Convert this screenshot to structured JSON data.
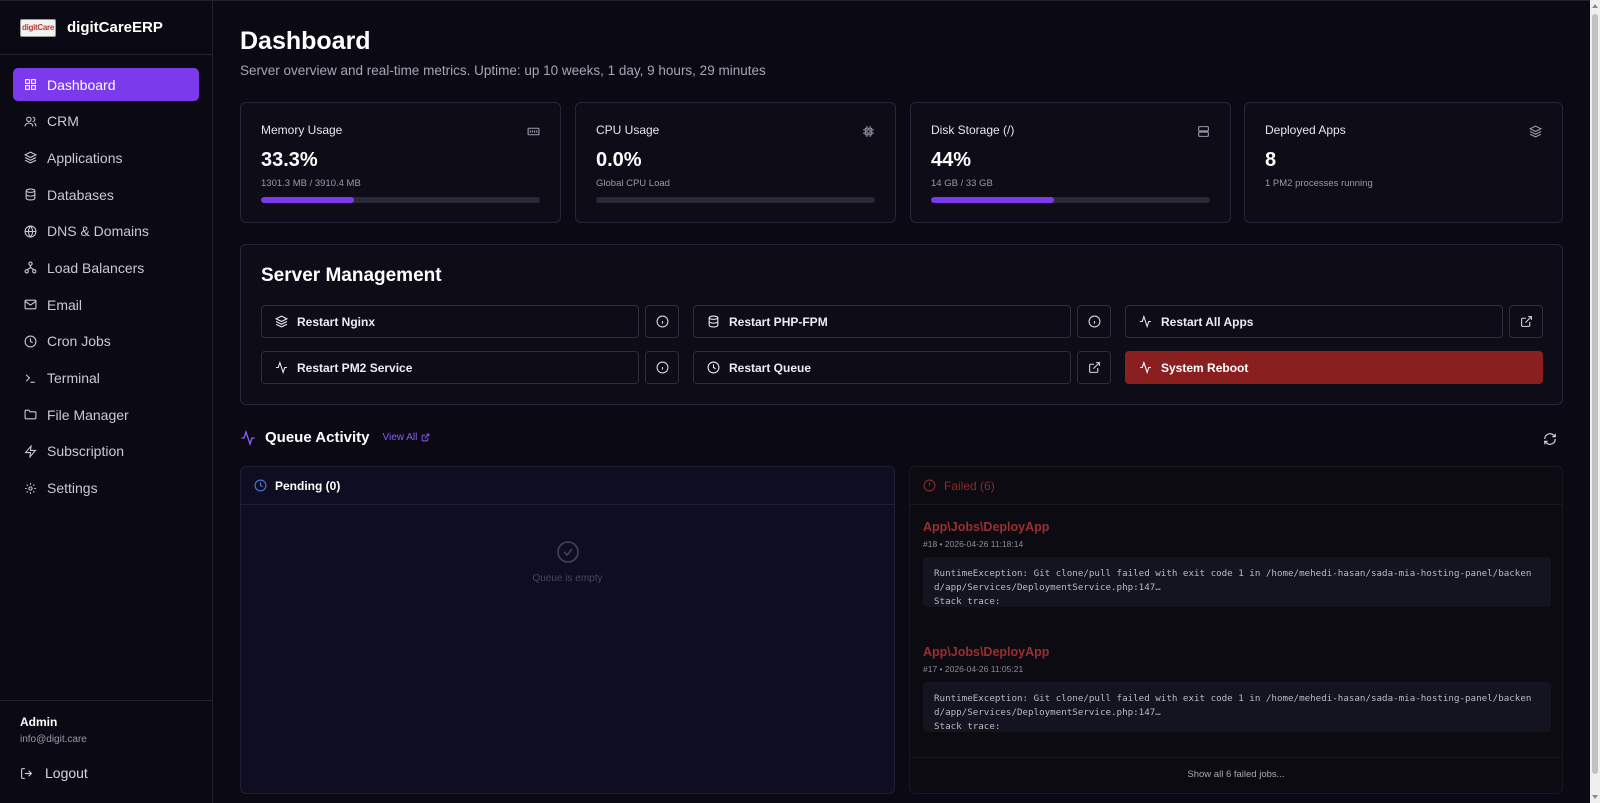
{
  "brand": {
    "logo_text": "digitCare",
    "name": "digitCareERP"
  },
  "sidebar": {
    "items": [
      {
        "label": "Dashboard",
        "icon": "grid-icon"
      },
      {
        "label": "CRM",
        "icon": "users-icon"
      },
      {
        "label": "Applications",
        "icon": "layers-icon"
      },
      {
        "label": "Databases",
        "icon": "database-icon"
      },
      {
        "label": "DNS & Domains",
        "icon": "globe-icon"
      },
      {
        "label": "Load Balancers",
        "icon": "network-icon"
      },
      {
        "label": "Email",
        "icon": "mail-icon"
      },
      {
        "label": "Cron Jobs",
        "icon": "clock-icon"
      },
      {
        "label": "Terminal",
        "icon": "terminal-icon"
      },
      {
        "label": "File Manager",
        "icon": "folder-icon"
      },
      {
        "label": "Subscription",
        "icon": "zap-icon"
      },
      {
        "label": "Settings",
        "icon": "gear-icon"
      }
    ],
    "active_index": 0,
    "user": {
      "name": "Admin",
      "email": "info@digit.care"
    },
    "logout_label": "Logout"
  },
  "header": {
    "title": "Dashboard",
    "subtitle": "Server overview and real-time metrics. Uptime: up 10 weeks, 1 day, 9 hours, 29 minutes"
  },
  "cards": {
    "memory": {
      "label": "Memory Usage",
      "value": "33.3%",
      "detail": "1301.3 MB / 3910.4 MB",
      "percent": 33.3,
      "icon": "memory-icon"
    },
    "cpu": {
      "label": "CPU Usage",
      "value": "0.0%",
      "detail": "Global CPU Load",
      "percent": 0,
      "icon": "cpu-icon"
    },
    "disk": {
      "label": "Disk Storage (/)",
      "value": "44%",
      "detail": "14 GB / 33 GB",
      "percent": 44,
      "icon": "server-icon"
    },
    "apps": {
      "label": "Deployed Apps",
      "value": "8",
      "detail": "1 PM2 processes running",
      "icon": "layers-icon"
    }
  },
  "management": {
    "title": "Server Management",
    "restart_nginx": "Restart Nginx",
    "restart_php": "Restart PHP-FPM",
    "restart_all": "Restart All Apps",
    "restart_pm2": "Restart PM2 Service",
    "restart_queue": "Restart Queue",
    "reboot": "System Reboot"
  },
  "queue": {
    "title": "Queue Activity",
    "view_all": "View All",
    "pending_label": "Pending (0)",
    "empty_text": "Queue is empty",
    "failed_label": "Failed (6)",
    "jobs": [
      {
        "name": "App\\Jobs\\DeployApp",
        "meta": "#18  •  2026-04-26 11:18:14",
        "trace": "RuntimeException: Git clone/pull failed with exit code 1 in /home/mehedi-hasan/sada-mia-hosting-panel/backend/app/Services/DeploymentService.php:147…",
        "trace2": "Stack trace:"
      },
      {
        "name": "App\\Jobs\\DeployApp",
        "meta": "#17  •  2026-04-26 11:05:21",
        "trace": "RuntimeException: Git clone/pull failed with exit code 1 in /home/mehedi-hasan/sada-mia-hosting-panel/backend/app/Services/DeploymentService.php:147…",
        "trace2": "Stack trace:"
      }
    ],
    "show_all": "Show all 6 failed jobs..."
  },
  "colors": {
    "accent": "#7c3aed",
    "danger": "#8a1f1f",
    "failed_text": "#9b2f2f"
  }
}
